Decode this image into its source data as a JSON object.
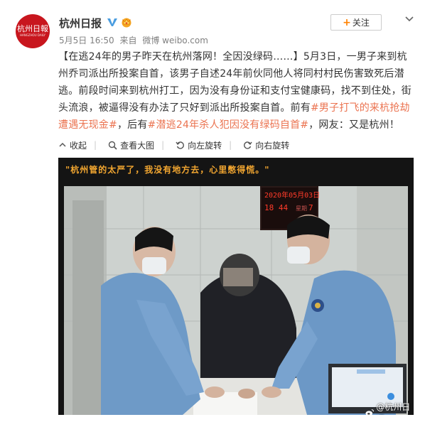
{
  "account": {
    "name": "杭州日报",
    "avatar_logo": "杭州日報",
    "avatar_sub": "HANGZHOU DAILY",
    "follow_label": "关注",
    "date": "5月5日 16:50",
    "source_prefix": "来自",
    "source": "微博 weibo.com"
  },
  "post": {
    "part1": "【在逃24年的男子昨天在杭州落网！全因没绿码……】5月3日，一男子来到杭州乔司派出所投案自首，该男子自述24年前伙同他人将同村村民伤害致死后潜逃。前段时间来到杭州打工，因为没有身份证和支付宝健康码，找不到住处，街头流浪，被逼得没有办法了只好到派出所投案自首。前有",
    "hashtag1": "#男子打飞的来杭抢劫遭遇无现金#",
    "part2": "，后有",
    "hashtag2": "#潜逃24年杀人犯因没有绿码自首#",
    "part3": "，网友：又是杭州！"
  },
  "toolbar": {
    "collapse": "收起",
    "view_large": "查看大图",
    "rotate_left": "向左旋转",
    "rotate_right": "向右旋转"
  },
  "image": {
    "quote": "\"杭州管的太严了，我没有地方去，心里憋得慌。\"",
    "clock_date": "2020年05月03日",
    "clock_time": "18 44",
    "clock_label1": "星期",
    "clock_day": "7",
    "watermark": "@杭州日报"
  },
  "colors": {
    "hashtag": "#eb7350",
    "accent": "#ff8200",
    "quote": "#f2a630",
    "avatar": "#c8161e"
  },
  "icons": [
    "verified-badge-icon",
    "vip-crown-icon",
    "chevron-down-icon",
    "collapse-icon",
    "magnifier-icon",
    "rotate-left-icon",
    "rotate-right-icon",
    "weibo-icon"
  ]
}
